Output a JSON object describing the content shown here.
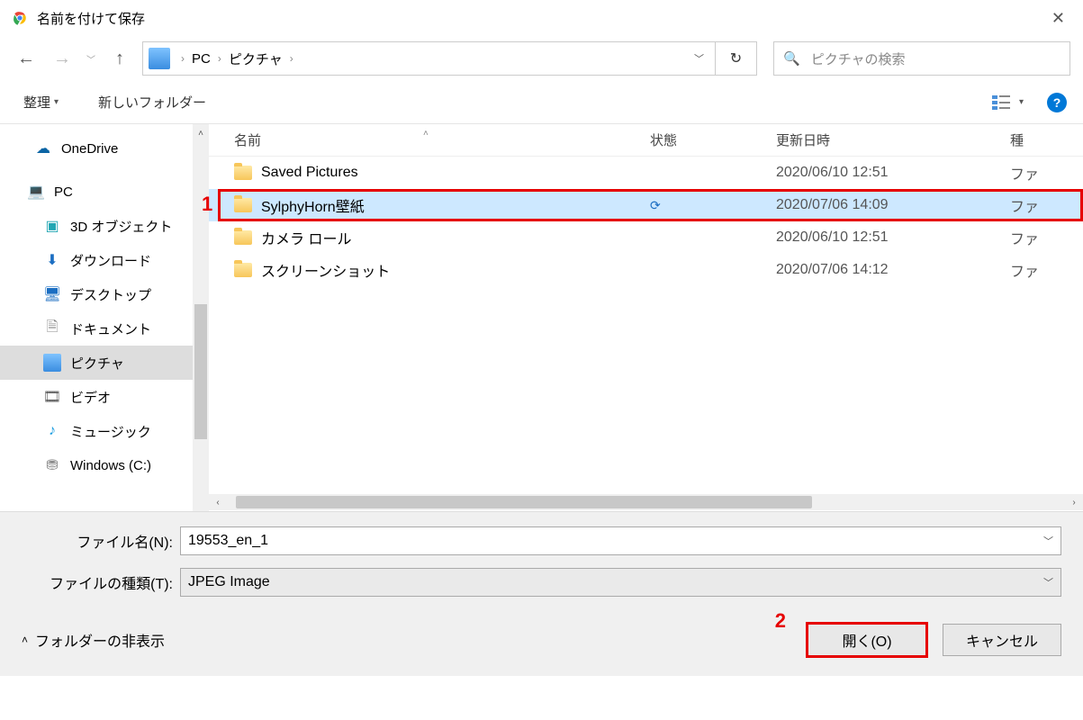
{
  "window": {
    "title": "名前を付けて保存"
  },
  "breadcrumb": {
    "root": "PC",
    "folder": "ピクチャ"
  },
  "search": {
    "placeholder": "ピクチャの検索"
  },
  "toolbar": {
    "organize": "整理",
    "new_folder": "新しいフォルダー"
  },
  "columns": {
    "name": "名前",
    "state": "状態",
    "date": "更新日時",
    "type_partial": "種"
  },
  "sidebar": {
    "onedrive": "OneDrive",
    "pc": "PC",
    "items": [
      "3D オブジェクト",
      "ダウンロード",
      "デスクトップ",
      "ドキュメント",
      "ピクチャ",
      "ビデオ",
      "ミュージック",
      "Windows (C:)"
    ]
  },
  "files": [
    {
      "name": "Saved Pictures",
      "state": "",
      "date": "2020/06/10 12:51",
      "type": "ファ"
    },
    {
      "name": "SylphyHorn壁紙",
      "state": "⟳",
      "date": "2020/07/06 14:09",
      "type": "ファ"
    },
    {
      "name": "カメラ ロール",
      "state": "",
      "date": "2020/06/10 12:51",
      "type": "ファ"
    },
    {
      "name": "スクリーンショット",
      "state": "",
      "date": "2020/07/06 14:12",
      "type": "ファ"
    }
  ],
  "filename": {
    "label": "ファイル名(N):",
    "value": "19553_en_1"
  },
  "filetype": {
    "label": "ファイルの種類(T):",
    "value": "JPEG Image"
  },
  "footer": {
    "hide_folders": "フォルダーの非表示",
    "open": "開く(O)",
    "cancel": "キャンセル"
  },
  "annotations": {
    "one": "1",
    "two": "2"
  }
}
